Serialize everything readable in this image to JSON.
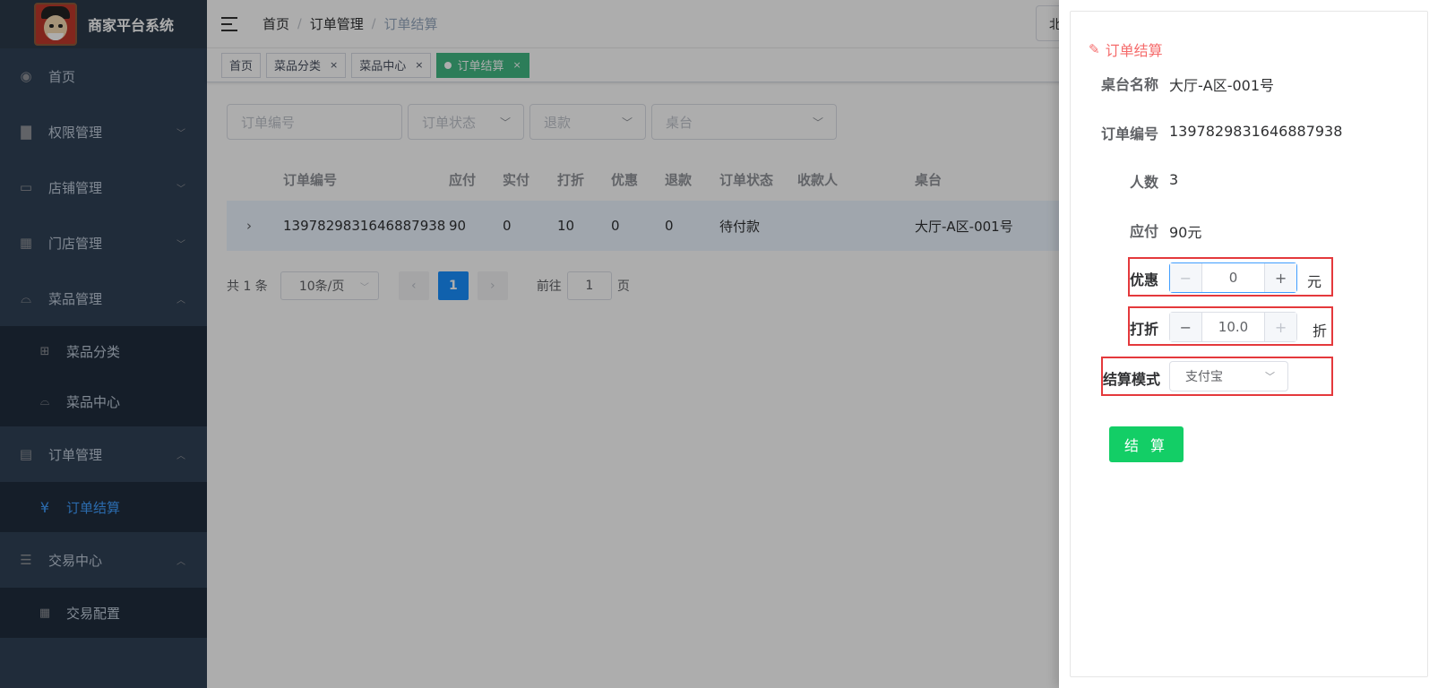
{
  "app": {
    "title": "商家平台系统"
  },
  "sidebar": {
    "items": [
      {
        "label": "首页",
        "icon": "dashboard-icon"
      },
      {
        "label": "权限管理",
        "icon": "lock-icon"
      },
      {
        "label": "店铺管理",
        "icon": "store-icon"
      },
      {
        "label": "门店管理",
        "icon": "building-icon"
      },
      {
        "label": "菜品管理",
        "icon": "cloche-icon"
      },
      {
        "label": "菜品分类",
        "icon": "grid-icon"
      },
      {
        "label": "菜品中心",
        "icon": "cloche-icon"
      },
      {
        "label": "订单管理",
        "icon": "document-icon"
      },
      {
        "label": "订单结算",
        "icon": "yen-icon"
      },
      {
        "label": "交易中心",
        "icon": "list-icon"
      },
      {
        "label": "交易配置",
        "icon": "table-icon"
      }
    ]
  },
  "breadcrumb": [
    "首页",
    "订单管理",
    "订单结算"
  ],
  "user_box": {
    "label": "北"
  },
  "tags": [
    {
      "label": "首页"
    },
    {
      "label": "菜品分类",
      "close": "×"
    },
    {
      "label": "菜品中心",
      "close": "×"
    },
    {
      "label": "订单结算",
      "close": "×"
    }
  ],
  "filters": {
    "order_no_placeholder": "订单编号",
    "status_placeholder": "订单状态",
    "refund_placeholder": "退款",
    "table_placeholder": "桌台"
  },
  "table": {
    "headers": [
      "订单编号",
      "应付",
      "实付",
      "打折",
      "优惠",
      "退款",
      "订单状态",
      "收款人",
      "桌台"
    ],
    "rows": [
      {
        "order_no": "1397829831646887938",
        "payable": "90",
        "paid": "0",
        "discount": "10",
        "coupon": "0",
        "refund": "0",
        "status": "待付款",
        "cashier": "",
        "table": "大厅-A区-001号"
      }
    ]
  },
  "pagination": {
    "total": "共 1 条",
    "page_size": "10条/页",
    "current": "1",
    "goto_prefix": "前往",
    "goto_value": "1",
    "goto_suffix": "页"
  },
  "drawer": {
    "title": "订单结算",
    "fields": {
      "table_name_label": "桌台名称",
      "table_name_value": "大厅-A区-001号",
      "order_no_label": "订单编号",
      "order_no_value": "1397829831646887938",
      "people_label": "人数",
      "people_value": "3",
      "payable_label": "应付",
      "payable_value": "90元",
      "coupon_label": "优惠",
      "coupon_value": "0",
      "coupon_unit": "元",
      "discount_label": "打折",
      "discount_value": "10.0",
      "discount_unit": "折",
      "mode_label": "结算模式",
      "mode_value": "支付宝"
    },
    "submit_label": "结 算"
  },
  "colors": {
    "sidebar_bg": "#304156",
    "accent": "#409eff",
    "active_tag": "#42b983",
    "submit": "#13ce66",
    "highlight_box": "#e4393c"
  }
}
